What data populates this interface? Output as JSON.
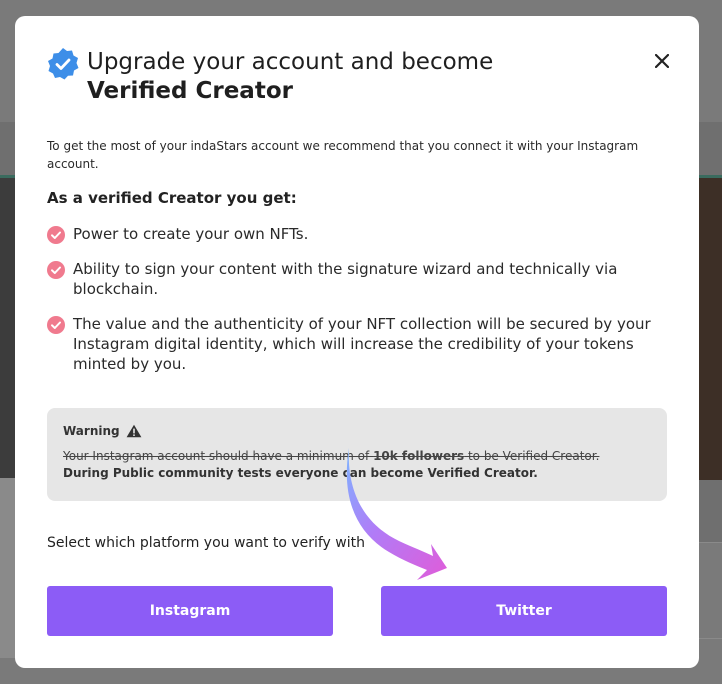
{
  "modal": {
    "title_line1": "Upgrade your account and become",
    "title_line2": "Verified Creator",
    "intro": "To get the most of your indaStars account we recommend that you connect it with your Instagram account.",
    "subtitle": "As a verified Creator you get:",
    "benefits": [
      "Power to create your own NFTs.",
      "Ability to sign your content with the signature wizard and technically via blockchain.",
      "The value and the authenticity of your NFT collection will be secured by your Instagram digital identity, which will increase the credibility of your tokens minted by you."
    ],
    "warning": {
      "label": "Warning",
      "strike_pre": "Your Instagram account should have a minimum of ",
      "strike_bold": "10k followers",
      "strike_post": " to be Verified Creator.",
      "note": "During Public community tests everyone can become Verified Creator."
    },
    "select_label": "Select which platform you want to verify with",
    "buttons": {
      "instagram": "Instagram",
      "twitter": "Twitter"
    }
  },
  "colors": {
    "accent": "#8c5cf6",
    "badge": "#3d8ee8",
    "check": "#f07a8e",
    "warning_bg": "#e6e6e6"
  },
  "icons": {
    "badge": "verified-badge-icon",
    "close": "close-icon",
    "check": "check-circle-icon",
    "warning": "warning-triangle-icon",
    "arrow": "curved-arrow-icon"
  }
}
